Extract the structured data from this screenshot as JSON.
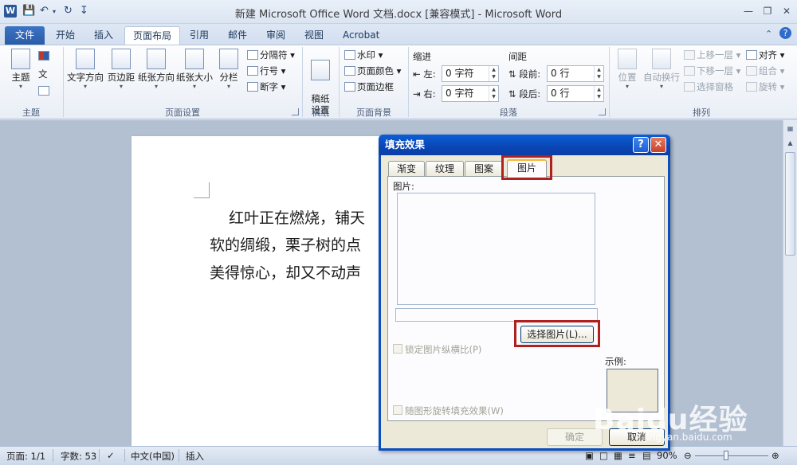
{
  "window": {
    "title": "新建 Microsoft Office Word 文档.docx [兼容模式] - Microsoft Word"
  },
  "tabs": [
    {
      "label": "文件"
    },
    {
      "label": "开始"
    },
    {
      "label": "插入"
    },
    {
      "label": "页面布局"
    },
    {
      "label": "引用"
    },
    {
      "label": "邮件"
    },
    {
      "label": "审阅"
    },
    {
      "label": "视图"
    },
    {
      "label": "Acrobat"
    }
  ],
  "ribbon": {
    "theme": {
      "group_label": "主题",
      "theme_button": "主题",
      "font_button": "文"
    },
    "page_setup": {
      "group_label": "页面设置",
      "text_direction": "文字方向",
      "margins": "页边距",
      "orientation": "纸张方向",
      "size": "纸张大小",
      "columns": "分栏",
      "breaks": "分隔符",
      "line_numbers": "行号",
      "hyphenation": "断字"
    },
    "draft": {
      "group_label": "稿纸",
      "draft_setup": "稿纸\n设置"
    },
    "page_background": {
      "group_label": "页面背景",
      "watermark": "水印",
      "page_color": "页面颜色",
      "page_borders": "页面边框"
    },
    "paragraph": {
      "group_label": "段落",
      "indent_label": "缩进",
      "indent_left_label": "左:",
      "indent_left_value": "0 字符",
      "indent_right_label": "右:",
      "indent_right_value": "0 字符",
      "spacing_label": "间距",
      "spacing_before_label": "段前:",
      "spacing_before_value": "0 行",
      "spacing_after_label": "段后:",
      "spacing_after_value": "0 行"
    },
    "arrange": {
      "group_label": "排列",
      "position": "位置",
      "wrap_text": "自动换行",
      "bring_forward": "上移一层",
      "send_backward": "下移一层",
      "selection_pane": "选择窗格",
      "align": "对齐",
      "group": "组合",
      "rotate": "旋转"
    }
  },
  "document": {
    "lines": [
      "红叶正在燃烧，铺天",
      "软的绸缎，栗子树的点",
      "美得惊心，却又不动声"
    ]
  },
  "dialog": {
    "title": "填充效果",
    "help": "?",
    "close": "✕",
    "tabs": [
      "渐变",
      "纹理",
      "图案",
      "图片"
    ],
    "active_tab": "图片",
    "picture_label": "图片:",
    "select_picture_button": "选择图片(L)...",
    "lock_aspect_label": "锁定图片纵横比(P)",
    "rotate_with_shape_label": "随图形旋转填充效果(W)",
    "sample_label": "示例:",
    "ok_button": "确定",
    "cancel_button": "取消"
  },
  "statusbar": {
    "page": "页面: 1/1",
    "words": "字数: 53",
    "language": "中文(中国)",
    "insert_mode": "插入",
    "zoom": "90%"
  },
  "watermark": {
    "brand": "Baidu经验",
    "url": "jingyan.baidu.com"
  },
  "colors": {
    "file_tab": "#2a5ba8",
    "dialog_title": "#0b46b4",
    "highlight": "#b0201f"
  }
}
